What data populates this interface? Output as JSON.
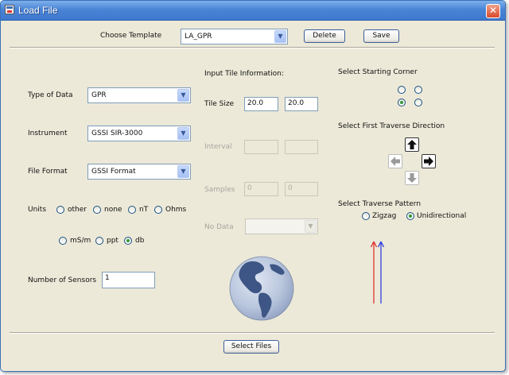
{
  "window": {
    "title": "Load File"
  },
  "template": {
    "label": "Choose Template",
    "value": "LA_GPR",
    "delete_label": "Delete",
    "save_label": "Save"
  },
  "left": {
    "type_of_data": {
      "label": "Type of Data",
      "value": "GPR"
    },
    "instrument": {
      "label": "Instrument",
      "value": "GSSI SIR-3000"
    },
    "file_format": {
      "label": "File Format",
      "value": "GSSI Format"
    },
    "units": {
      "label": "Units",
      "options": [
        "other",
        "none",
        "nT",
        "Ohms",
        "mS/m",
        "ppt",
        "db"
      ],
      "selected": "db"
    },
    "sensors": {
      "label": "Number of Sensors",
      "value": "1"
    }
  },
  "tile": {
    "header": "Input Tile Information:",
    "tile_size": {
      "label": "Tile Size",
      "x": "20.0",
      "y": "20.0"
    },
    "interval": {
      "label": "Interval",
      "x": "",
      "y": ""
    },
    "samples": {
      "label": "Samples",
      "x": "0",
      "y": "0"
    },
    "no_data": {
      "label": "No Data",
      "value": ""
    }
  },
  "right": {
    "corner": {
      "label": "Select Starting Corner",
      "selected": "bottom-left"
    },
    "traverse_direction": {
      "label": "Select First Traverse Direction",
      "active": [
        "up",
        "right"
      ],
      "disabled": [
        "left",
        "down"
      ]
    },
    "pattern": {
      "label": "Select Traverse Pattern",
      "options": [
        "Zigzag",
        "Unidirectional"
      ],
      "selected": "Unidirectional"
    }
  },
  "preview": {
    "up_line_colors": [
      "#dd2222",
      "#2233dd"
    ]
  },
  "footer": {
    "select_files_label": "Select Files"
  },
  "colors": {
    "title_bar": "#3e78cf",
    "radio_selected": "#2f9a3a",
    "panel": "#ece9d8"
  }
}
